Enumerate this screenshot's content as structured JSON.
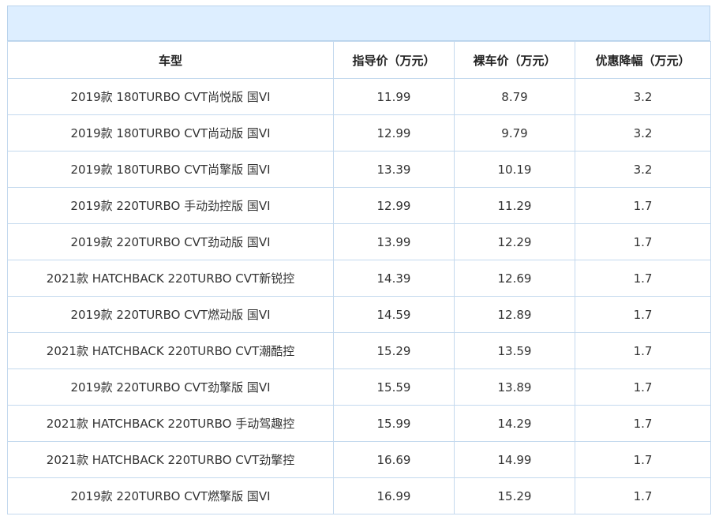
{
  "table": {
    "title": "",
    "headers": [
      "车型",
      "指导价（万元）",
      "裸车价（万元）",
      "优惠降幅（万元）"
    ],
    "rows": [
      [
        "2019款 180TURBO CVT尚悦版 国VI",
        "11.99",
        "8.79",
        "3.2"
      ],
      [
        "2019款 180TURBO CVT尚动版 国VI",
        "12.99",
        "9.79",
        "3.2"
      ],
      [
        "2019款 180TURBO CVT尚擎版 国VI",
        "13.39",
        "10.19",
        "3.2"
      ],
      [
        "2019款 220TURBO 手动劲控版 国VI",
        "12.99",
        "11.29",
        "1.7"
      ],
      [
        "2019款 220TURBO CVT劲动版 国VI",
        "13.99",
        "12.29",
        "1.7"
      ],
      [
        "2021款 HATCHBACK 220TURBO CVT新锐控",
        "14.39",
        "12.69",
        "1.7"
      ],
      [
        "2019款 220TURBO CVT燃动版 国VI",
        "14.59",
        "12.89",
        "1.7"
      ],
      [
        "2021款 HATCHBACK 220TURBO CVT潮酷控",
        "15.29",
        "13.59",
        "1.7"
      ],
      [
        "2019款 220TURBO CVT劲擎版 国VI",
        "15.59",
        "13.89",
        "1.7"
      ],
      [
        "2021款 HATCHBACK 220TURBO 手动驾趣控",
        "15.99",
        "14.29",
        "1.7"
      ],
      [
        "2021款 HATCHBACK 220TURBO CVT劲擎控",
        "16.69",
        "14.99",
        "1.7"
      ],
      [
        "2019款 220TURBO CVT燃擎版 国VI",
        "16.99",
        "15.29",
        "1.7"
      ]
    ]
  },
  "colors": {
    "title_bar_bg": "#ddeeff",
    "border": "#c4d9ee",
    "text": "#333333"
  }
}
